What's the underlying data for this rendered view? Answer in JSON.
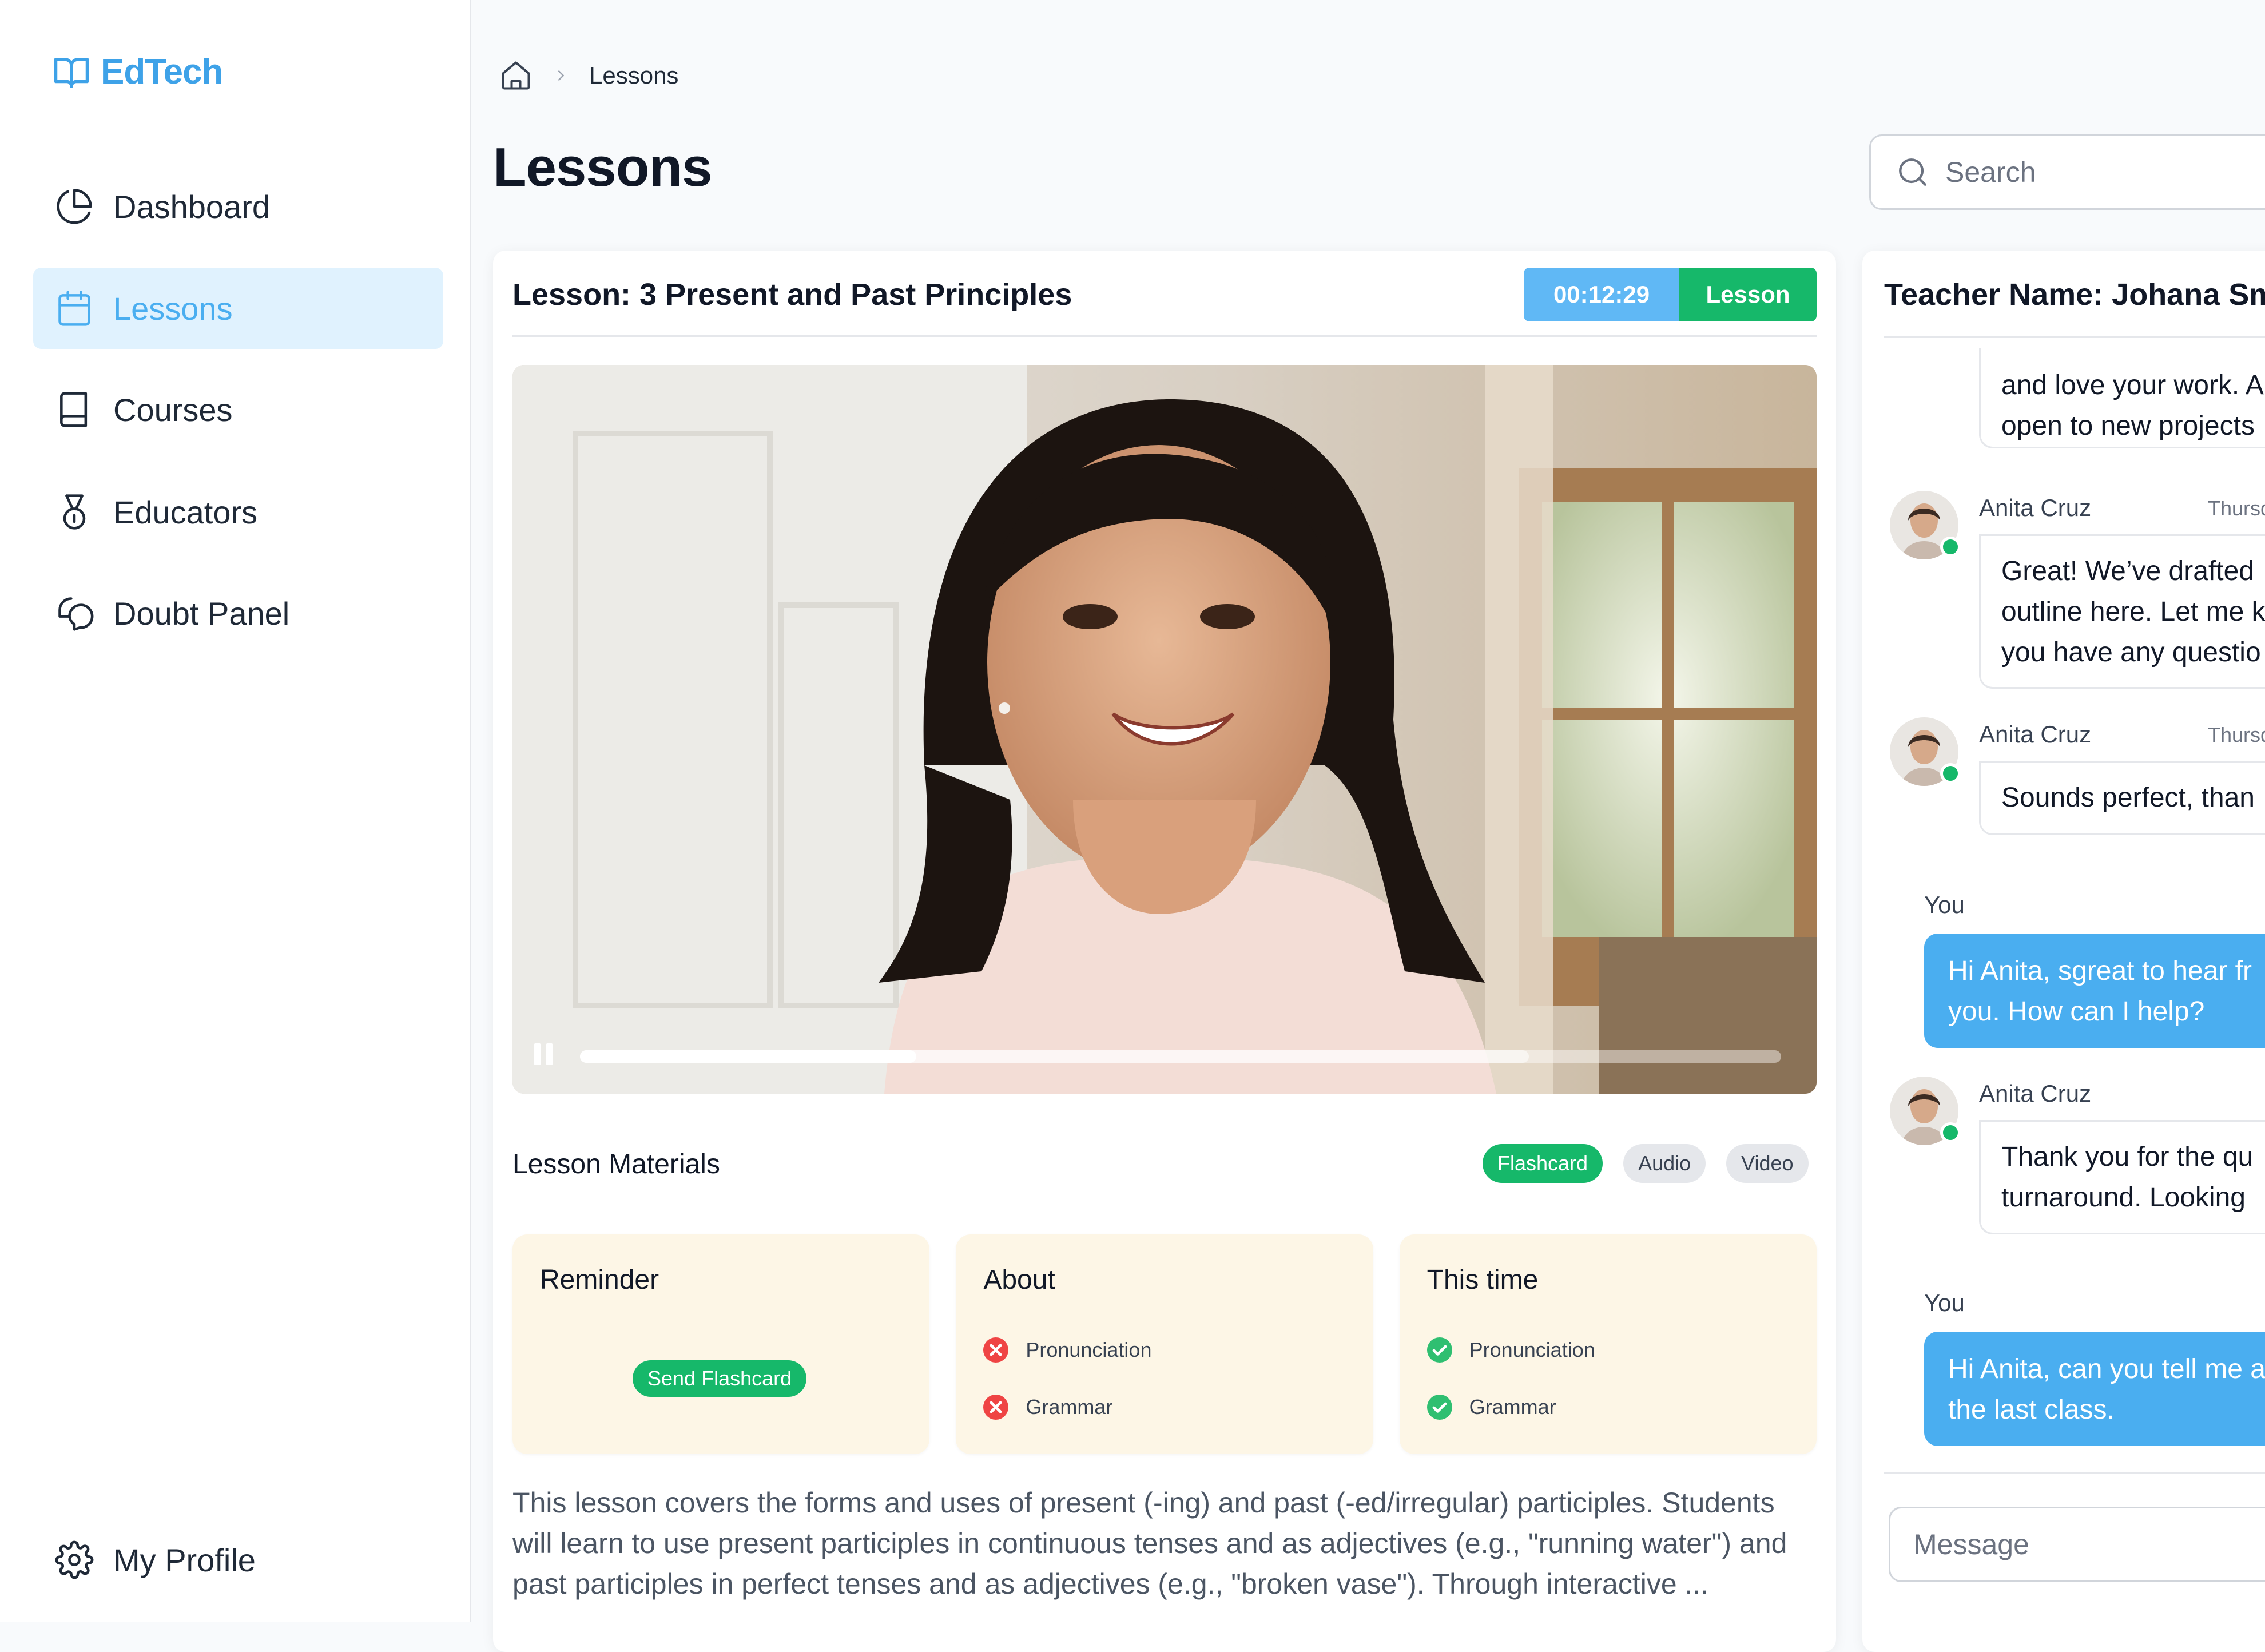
{
  "app": {
    "logo_text": "EdTech"
  },
  "sidebar": {
    "items": [
      {
        "label": "Dashboard",
        "icon": "pie-chart-icon"
      },
      {
        "label": "Lessons",
        "icon": "calendar-icon",
        "active": true
      },
      {
        "label": "Courses",
        "icon": "book-icon"
      },
      {
        "label": "Educators",
        "icon": "medal-icon"
      },
      {
        "label": "Doubt Panel",
        "icon": "chat-bubbles-icon"
      }
    ],
    "profile_label": "My Profile"
  },
  "header": {
    "breadcrumb": {
      "home_icon": "home-icon",
      "current": "Lessons"
    },
    "title": "Lessons",
    "search_placeholder": "Search"
  },
  "lesson": {
    "title": "Lesson: 3 Present and Past Principles",
    "timer": "00:12:29",
    "badge": "Lesson",
    "video": {
      "played": 0.28,
      "buffered": 0.79
    },
    "materials_label": "Lesson Materials",
    "material_tags": [
      {
        "label": "Flashcard",
        "active": true
      },
      {
        "label": "Audio",
        "active": false
      },
      {
        "label": "Video",
        "active": false
      }
    ],
    "cards": {
      "reminder": {
        "title": "Reminder",
        "button": "Send Flashcard"
      },
      "about": {
        "title": "About",
        "items": [
          "Pronunciation",
          "Grammar"
        ],
        "status": "incorrect"
      },
      "this_time": {
        "title": "This time",
        "items": [
          "Pronunciation",
          "Grammar"
        ],
        "status": "correct"
      }
    },
    "description": "This lesson covers the forms and uses of present (-ing) and past (-ed/irregular) participles. Students will learn to use present participles in continuous tenses and as adjectives (e.g., \"running water\") and past participles in perfect tenses and as adjectives (e.g., \"broken vase\"). Through interactive ..."
  },
  "chat": {
    "teacher": "Teacher Name: Johana Smith",
    "messages": [
      {
        "text_lines": [
          "and love your work. A",
          "open to new projects"
        ]
      },
      {
        "sender": "Anita Cruz",
        "time": "Thursday",
        "text_lines": [
          "Great! We’ve drafted",
          "outline here. Let me k",
          "you have any questio"
        ]
      },
      {
        "sender": "Anita Cruz",
        "time": "Thursday",
        "text_lines": [
          "Sounds perfect, than"
        ]
      },
      {
        "you_label": "You",
        "text_lines": [
          "Hi Anita, sgreat to hear fr",
          "you. How can I help?"
        ]
      },
      {
        "sender": "Anita Cruz",
        "text_lines": [
          "Thank you for the qu",
          "turnaround. Looking"
        ]
      },
      {
        "you_label": "You",
        "text_lines": [
          "Hi Anita, can you tell me a",
          "the last class."
        ]
      }
    ],
    "message_placeholder": "Message"
  },
  "colors": {
    "accent": "#4aaef0",
    "green": "#16b86a",
    "card_bg": "#fdf6e6",
    "error": "#ef4444"
  }
}
